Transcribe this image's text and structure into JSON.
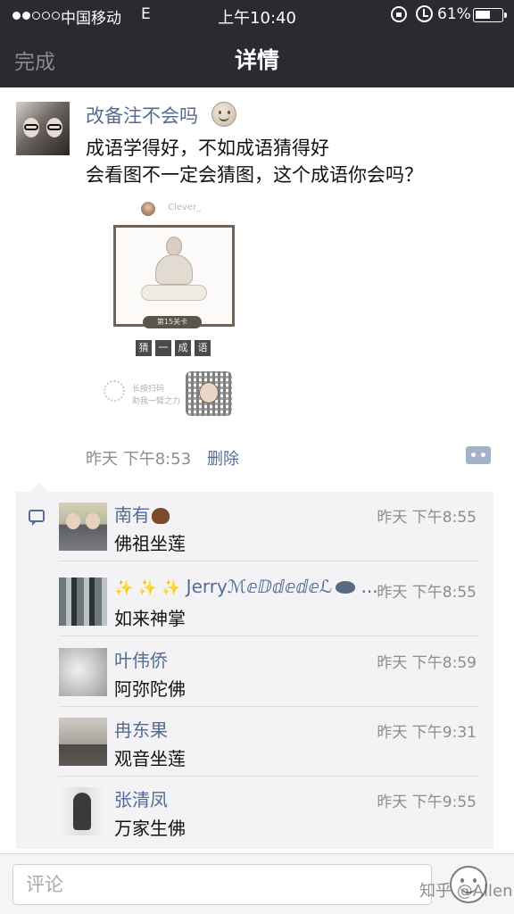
{
  "status_bar": {
    "carrier": "中国移动",
    "network": "E",
    "time": "上午10:40",
    "battery_text": "61%",
    "battery_level": 0.61,
    "signal_bars_filled": 2,
    "signal_bars_total": 5
  },
  "nav": {
    "back_label": "完成",
    "title": "详情"
  },
  "post": {
    "author": "改备注不会吗",
    "lines": [
      "成语学得好，不如成语猜得好",
      "会看图不一定会猜图，这个成语你会吗？"
    ],
    "image": {
      "mini_name": "Clever_",
      "level_text": "第15关卡",
      "guess_chars": [
        "猜",
        "一",
        "成",
        "语"
      ],
      "scan_text_1": "长按扫码",
      "scan_text_2": "助我一臂之力"
    },
    "time": "昨天 下午8:53",
    "delete_label": "删除"
  },
  "comments": [
    {
      "name": "南有",
      "time": "昨天 下午8:55",
      "text": "佛祖坐莲"
    },
    {
      "name": "Jerryℳⅇⅅⅆⅇⅆⅇℒ",
      "time": "昨天 下午8:55",
      "text": "如来神掌"
    },
    {
      "name": "叶伟侨",
      "time": "昨天 下午8:59",
      "text": "阿弥陀佛"
    },
    {
      "name": "冉东果",
      "time": "昨天 下午9:31",
      "text": "观音坐莲"
    },
    {
      "name": "张清凤",
      "time": "昨天 下午9:55",
      "text": "万家生佛"
    }
  ],
  "comment_bar": {
    "placeholder": "评论"
  },
  "watermark": "知乎 @Allen",
  "colors": {
    "nav_bg": "#2b2a30",
    "link": "#556a94",
    "comment_bg": "#f3f3f5",
    "muted": "#8d8d8d"
  }
}
